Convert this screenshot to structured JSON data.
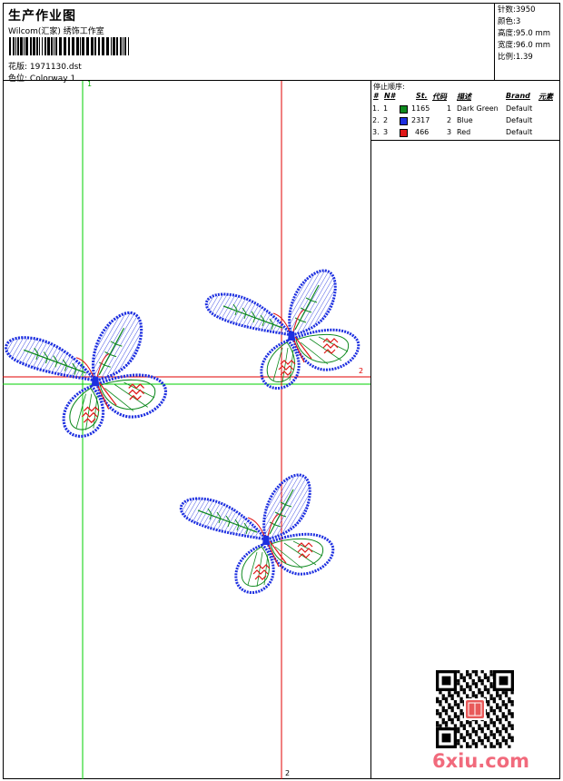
{
  "header": {
    "title": "生产作业图",
    "studio": "Wilcom(汇家) 绣饰工作室",
    "design_label": "花版:",
    "design_value": "1971130.dst",
    "color_label": "色位:",
    "color_value": "Colorway 1"
  },
  "stats": [
    {
      "label": "针数:",
      "value": "3950"
    },
    {
      "label": "颜色:",
      "value": "3"
    },
    {
      "label": "高度:",
      "value": "95.0 mm"
    },
    {
      "label": "宽度:",
      "value": "96.0 mm"
    },
    {
      "label": "比例:",
      "value": "1.39"
    }
  ],
  "stop_sequence": {
    "title": "停止顺序:",
    "headers": [
      "#",
      "N#",
      "St.",
      "代码",
      "描述",
      "Brand",
      "元素"
    ],
    "rows": [
      {
        "idx": "1.",
        "n": "1",
        "color": "#0f8a1f",
        "stitches": "1165",
        "code": "1",
        "desc": "Dark Green",
        "brand": "Default"
      },
      {
        "idx": "2.",
        "n": "2",
        "color": "#1d2fe0",
        "stitches": "2317",
        "code": "2",
        "desc": "Blue",
        "brand": "Default"
      },
      {
        "idx": "3.",
        "n": "3",
        "color": "#e01818",
        "stitches": "466",
        "code": "3",
        "desc": "Red",
        "brand": "Default"
      }
    ]
  },
  "markers": {
    "green": "1",
    "red_right": "2",
    "red_bottom": "2"
  },
  "watermark": "6xiu.com",
  "colors": {
    "green": "#0f8a1f",
    "blue": "#1d2fe0",
    "red": "#e01818",
    "guide_green": "#00d000",
    "guide_red": "#e00000"
  },
  "icons": {
    "qr": "qr-code-icon",
    "seal": "seal-stamp-icon"
  }
}
